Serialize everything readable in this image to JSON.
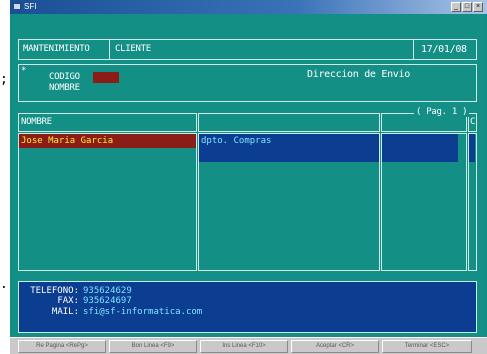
{
  "window": {
    "title": "SFI",
    "minimize_label": "_",
    "maximize_label": "□",
    "close_label": "×"
  },
  "left_edge_marks": {
    "top": ";",
    "bottom": "."
  },
  "header": {
    "section": "MANTENIMIENTO",
    "entity": "CLIENTE",
    "date": "17/01/08"
  },
  "client": {
    "marker": "*",
    "codigo_label": "CODIGO",
    "nombre_label": "NOMBRE",
    "codigo_value": "",
    "direccion_title": "Direccion de Envio"
  },
  "grid": {
    "col_nombre": "NOMBRE",
    "page_indicator": "( Pag. 1 )",
    "col_end": "C",
    "rows": [
      {
        "nombre": "Jose Maria Garcia",
        "direccion": "dpto. Compras",
        "extra": ""
      }
    ]
  },
  "contact": {
    "telefono_label": "TELEFONO:",
    "telefono_value": "935624629",
    "fax_label": "FAX:",
    "fax_value": "935624697",
    "mail_label": "MAIL:",
    "mail_value": "sfi@sf-informatica.com"
  },
  "statusbar": {
    "keys": [
      "Re Pagina <RePg>",
      "Bon Linea <F9>",
      "Ins Linea <F10>",
      "Aceptar  <CR>",
      "Terminar  <ESC>"
    ]
  }
}
